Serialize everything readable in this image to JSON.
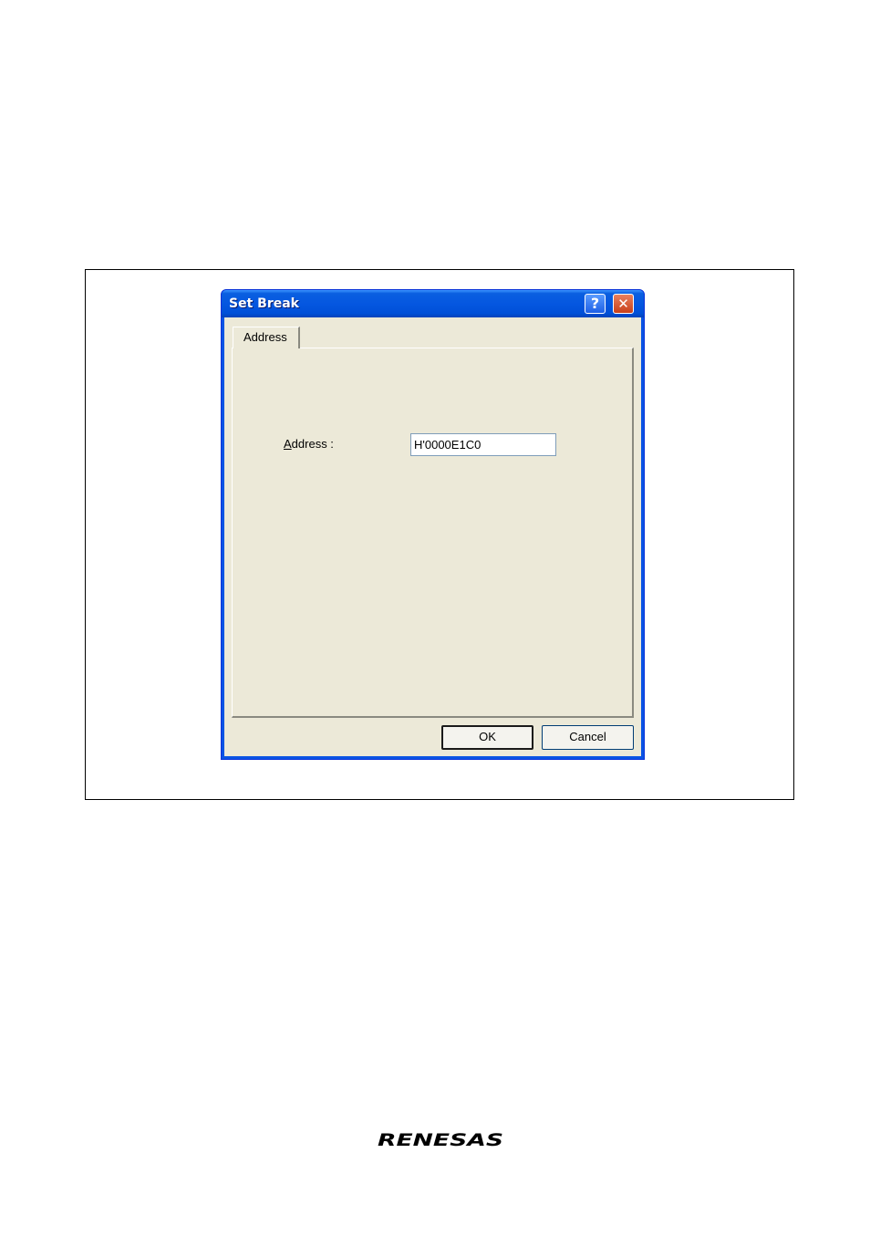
{
  "dialog": {
    "title": "Set Break",
    "help_glyph": "?",
    "close_glyph": "✕",
    "tab_label": "Address",
    "address_label": "Address :",
    "address_label_underline_char": "A",
    "address_label_rest": "ddress :",
    "address_value": "H'0000E1C0",
    "ok_label": "OK",
    "cancel_label": "Cancel"
  },
  "footer": {
    "logo_text": "RENESAS"
  },
  "colors": {
    "titlebar": "#0557e0",
    "client_bg": "#ece9d8",
    "close_button": "#c9401a"
  },
  "icons": {
    "help": "help-icon",
    "close": "close-icon",
    "logo": "renesas-logo"
  }
}
